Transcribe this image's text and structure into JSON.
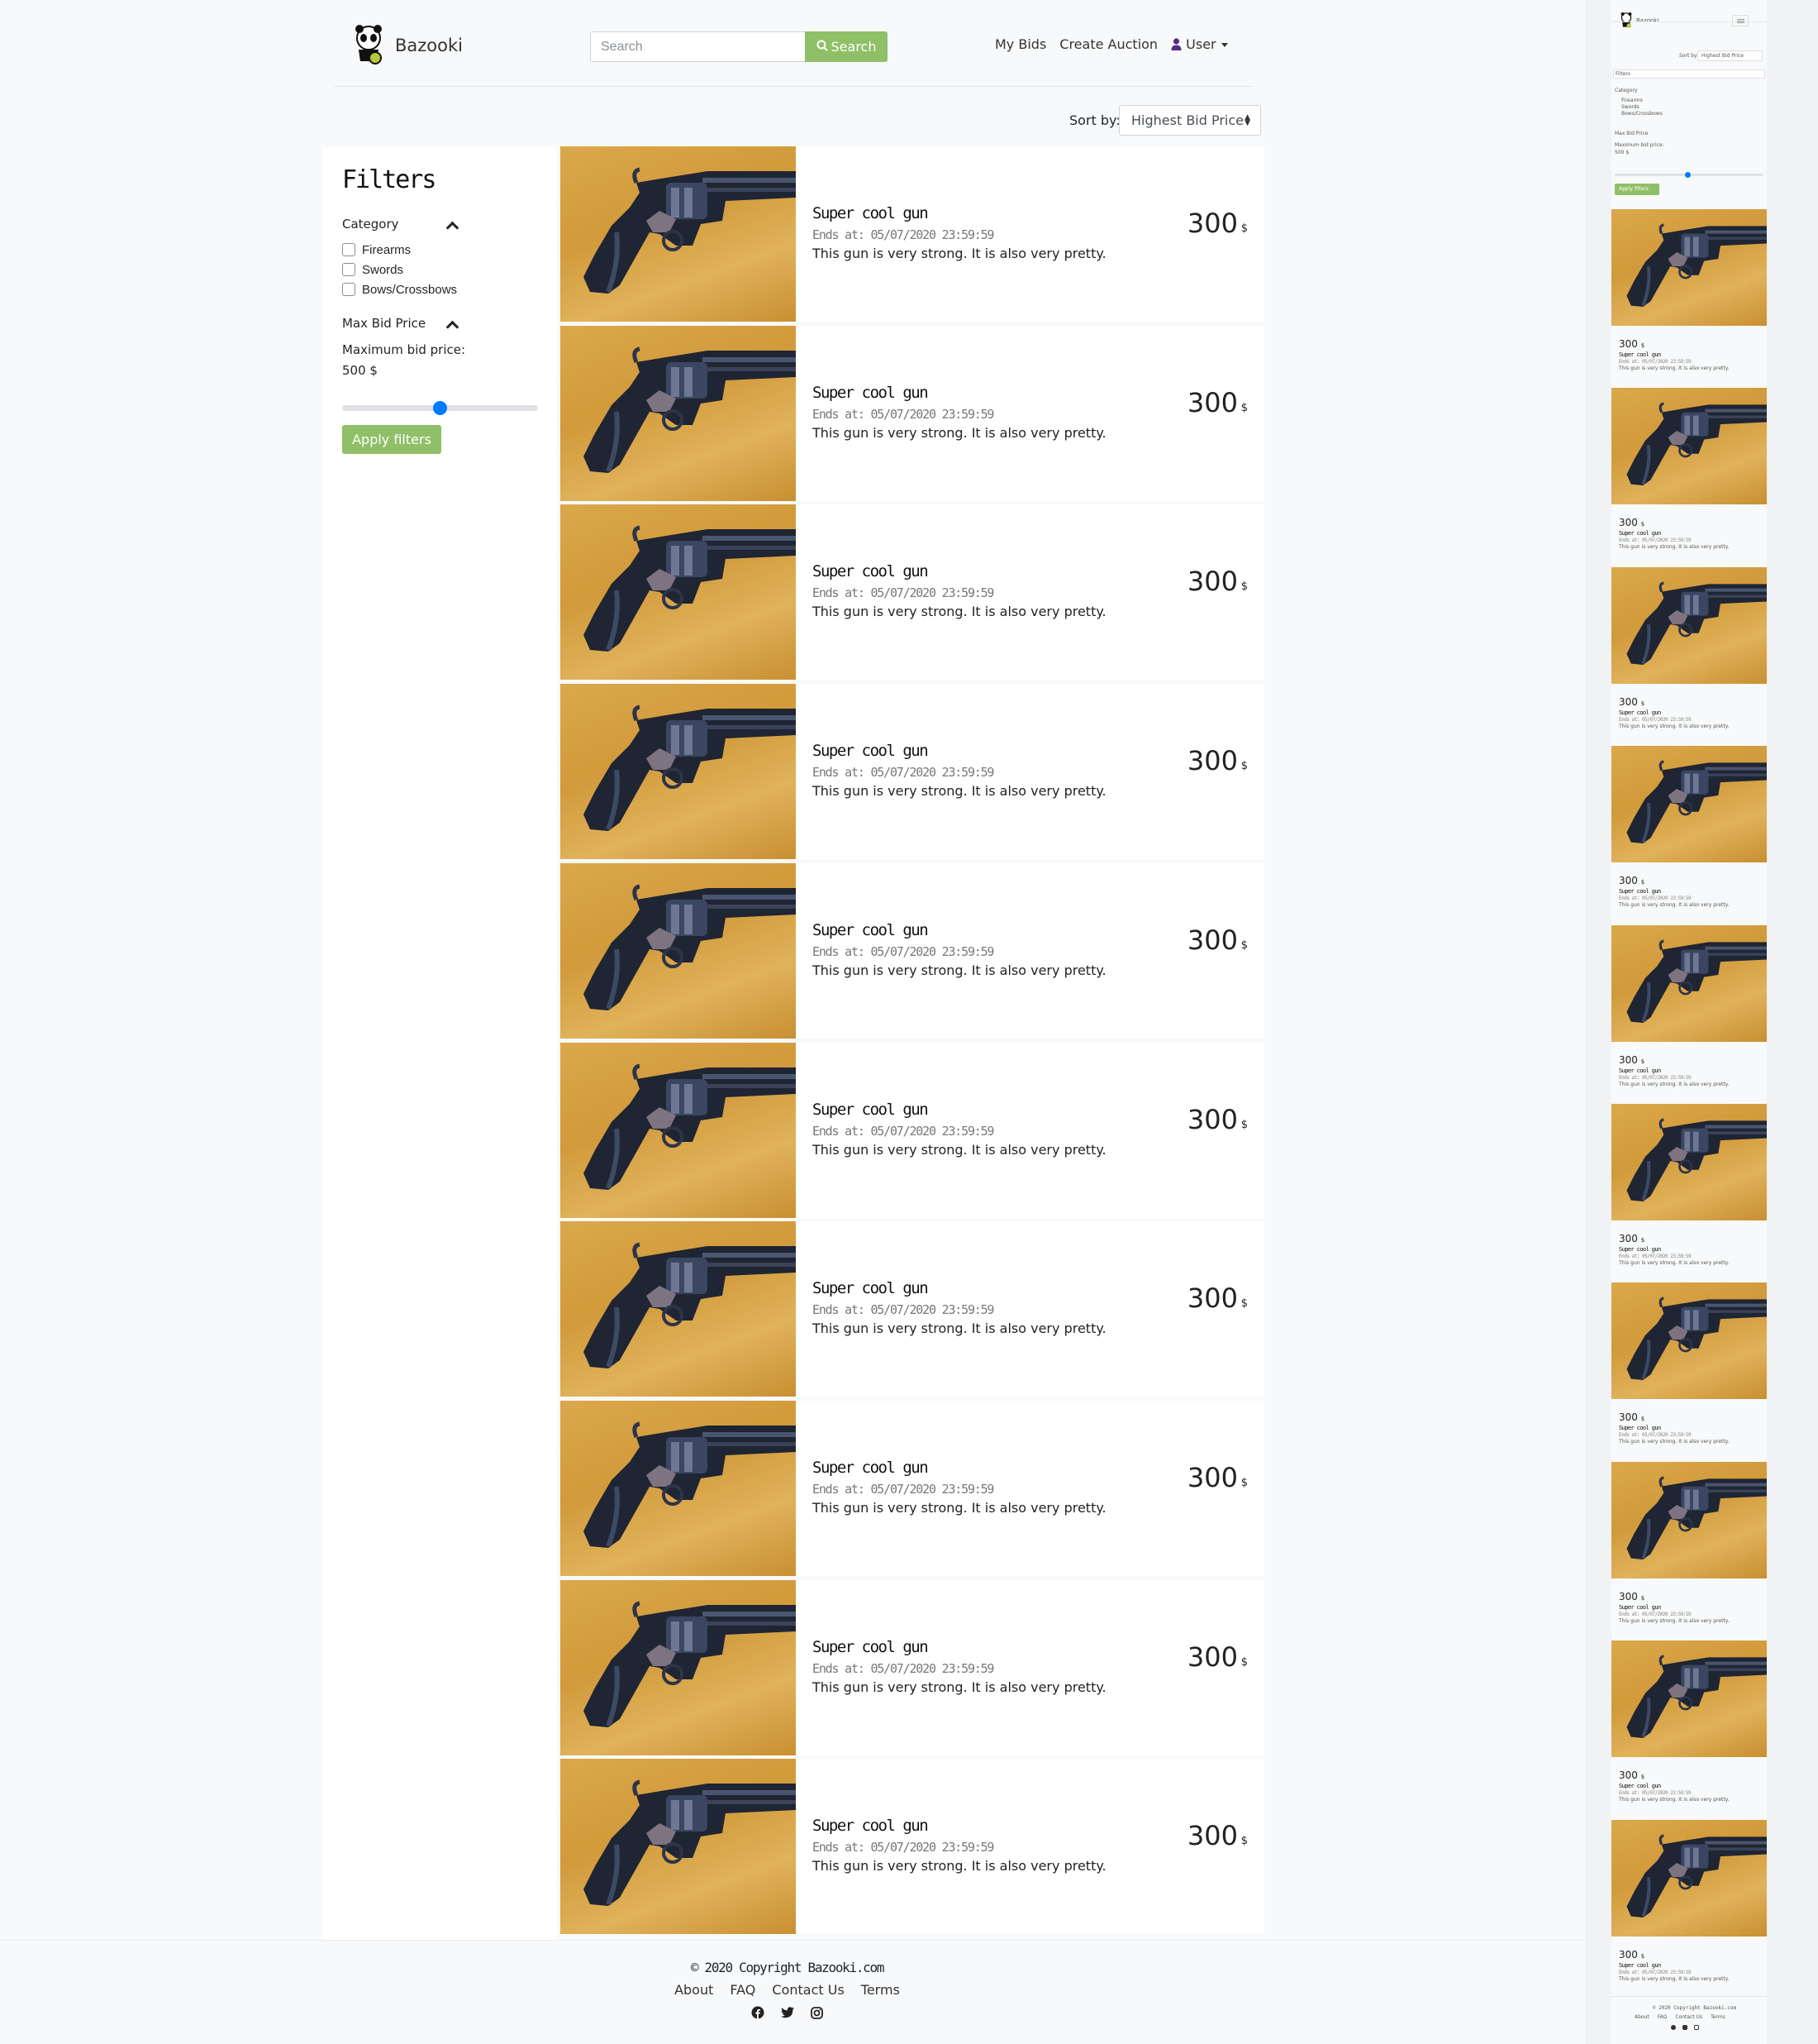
{
  "header": {
    "brand": "Bazooki",
    "search_placeholder": "Search",
    "search_button": "Search",
    "nav": {
      "my_bids": "My Bids",
      "create_auction": "Create Auction",
      "user": "User"
    }
  },
  "sort": {
    "label": "Sort by:",
    "selected": "Highest Bid Price"
  },
  "filters": {
    "title": "Filters",
    "category_label": "Category",
    "categories": [
      "Firearms",
      "Swords",
      "Bows/Crossbows"
    ],
    "max_bid_label": "Max Bid Price",
    "max_bid_text": "Maximum bid price:",
    "max_bid_value": "500 $",
    "slider_fraction": 0.5,
    "apply": "Apply filters"
  },
  "auction": {
    "title": "Super cool gun",
    "ends": "Ends at: 05/07/2020 23:59:59",
    "desc": "This gun is very strong. It is also very pretty.",
    "price": "300",
    "currency": "$"
  },
  "auction_count": 10,
  "mobile": {
    "filters_label": "Filters",
    "apply": "Apply filters"
  },
  "footer": {
    "copyright": "© 2020 Copyright Bazooki.com",
    "links": [
      "About",
      "FAQ",
      "Contact Us",
      "Terms"
    ],
    "icons": [
      "facebook-icon",
      "twitter-icon",
      "instagram-icon"
    ]
  },
  "colors": {
    "accent_green": "#8fbf67",
    "slider_blue": "#007bff",
    "user_icon": "#5b2a86"
  }
}
